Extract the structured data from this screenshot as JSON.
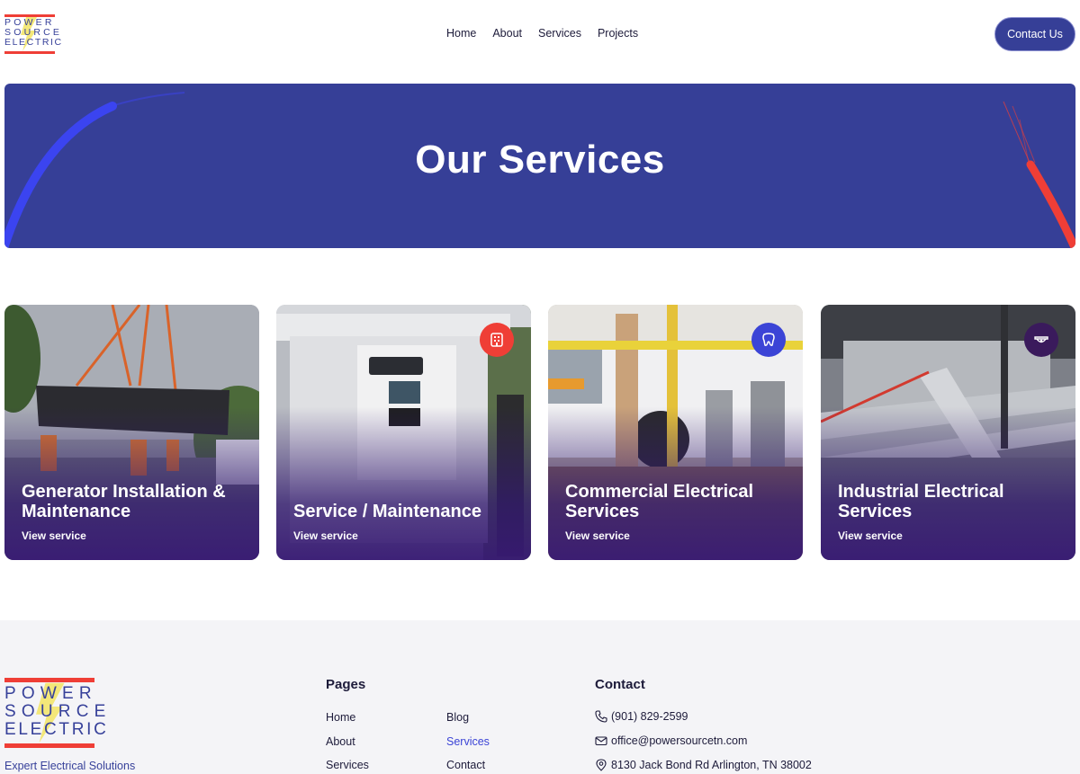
{
  "brand": {
    "logo_lines": [
      "POWER",
      "SOURCE",
      "ELECTRIC"
    ],
    "colors": {
      "primary": "#363f97",
      "accent": "#ef3e36",
      "bolt": "#f3e56a"
    }
  },
  "nav": {
    "items": [
      {
        "label": "Home"
      },
      {
        "label": "About"
      },
      {
        "label": "Services"
      },
      {
        "label": "Projects"
      }
    ],
    "cta_label": "Contact Us"
  },
  "hero": {
    "title": "Our Services"
  },
  "services": [
    {
      "title": "Generator Installation & Maintenance",
      "link": "View service",
      "icon": "none"
    },
    {
      "title": "Service / Maintenance",
      "link": "View service",
      "icon": "building-icon",
      "badge_color": "#ef3e36"
    },
    {
      "title": "Commercial Electrical Services",
      "link": "View service",
      "icon": "tooth-icon",
      "badge_color": "#3b44d6"
    },
    {
      "title": "Industrial Electrical Services",
      "link": "View service",
      "icon": "dome-light-icon",
      "badge_color": "#3a1a5c"
    }
  ],
  "footer": {
    "tagline": "Expert Electrical Solutions",
    "pages_heading": "Pages",
    "pages_col1": [
      "Home",
      "About",
      "Services"
    ],
    "pages_col2": [
      "Blog",
      "Services",
      "Contact"
    ],
    "contact_heading": "Contact",
    "phone": "(901) 829-2599",
    "email": "office@powersourcetn.com",
    "address": "8130 Jack Bond Rd Arlington, TN 38002"
  }
}
